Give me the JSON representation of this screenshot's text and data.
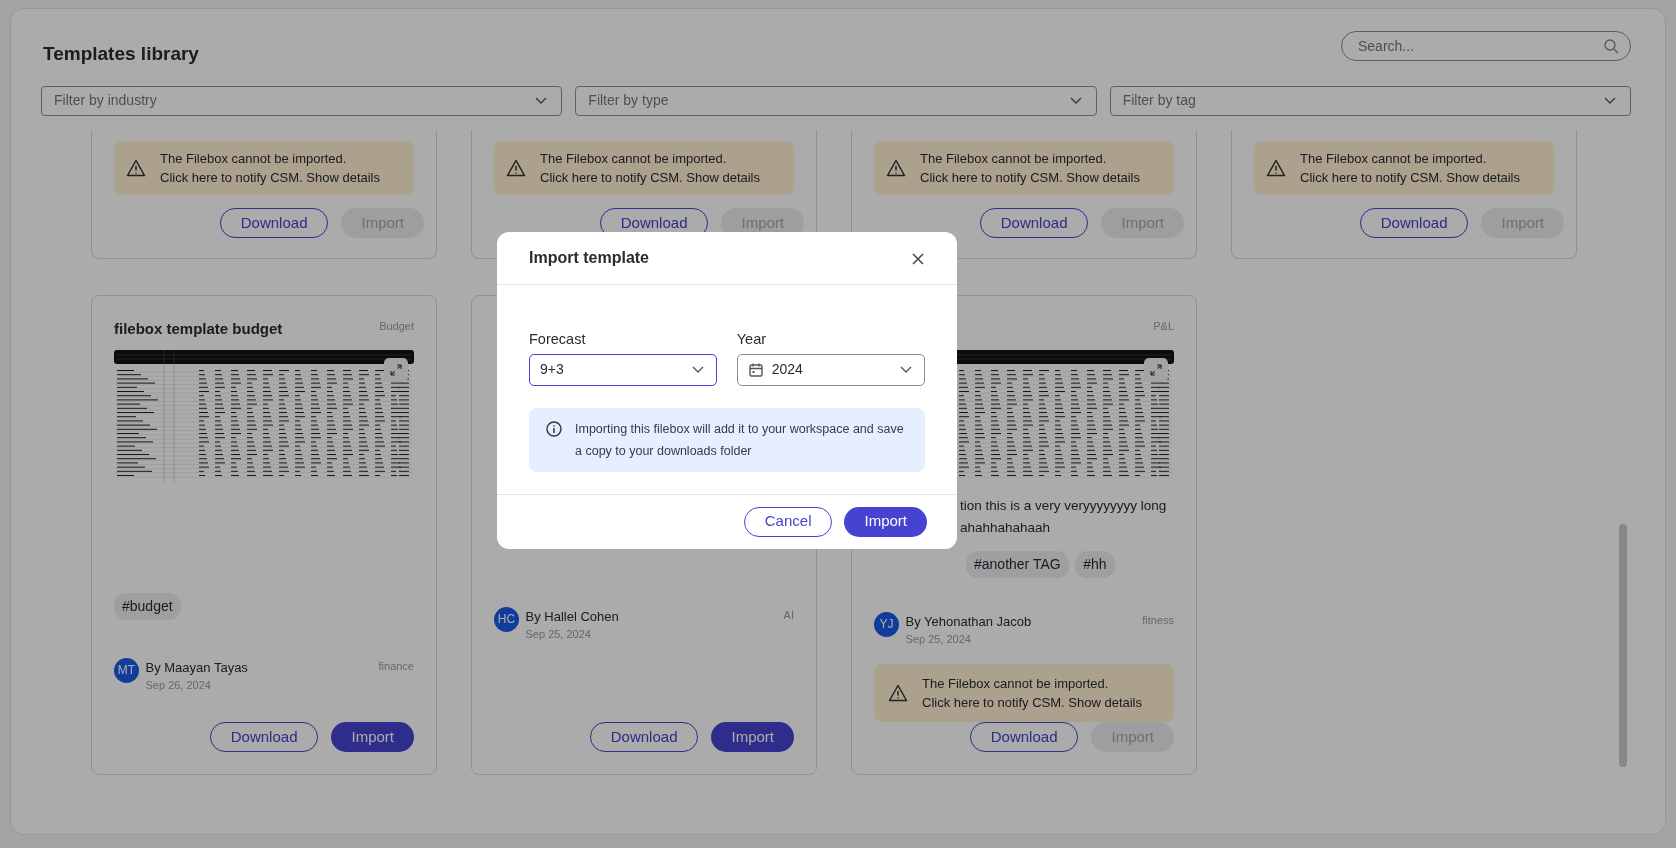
{
  "page": {
    "title": "Templates library",
    "search": {
      "placeholder": "Search..."
    },
    "filters": [
      {
        "placeholder": "Filter by industry"
      },
      {
        "placeholder": "Filter by type"
      },
      {
        "placeholder": "Filter by tag"
      }
    ]
  },
  "top_cards": [
    {
      "warning": {
        "text": "The Filebox cannot be imported.",
        "link": "Click here",
        "rest": "to notify CSM. Show details"
      },
      "buttons": [
        {
          "label": "Download",
          "kind": "outline",
          "disabled": false
        },
        {
          "label": "Import",
          "kind": "primary",
          "disabled": true
        }
      ]
    },
    {
      "warning": {
        "text": "The Filebox cannot be imported.",
        "link": "Click here",
        "rest": "to notify CSM. Show details"
      },
      "buttons": [
        {
          "label": "Download",
          "kind": "outline",
          "disabled": false
        },
        {
          "label": "Import",
          "kind": "primary",
          "disabled": true
        }
      ]
    },
    {
      "warning": {
        "text": "The Filebox cannot be imported.",
        "link": "Click here",
        "rest": "to notify CSM. Show details"
      },
      "buttons": [
        {
          "label": "Download",
          "kind": "outline",
          "disabled": false
        },
        {
          "label": "Import",
          "kind": "primary",
          "disabled": true
        }
      ]
    },
    {
      "warning": {
        "text": "The Filebox cannot be imported.",
        "link": "Click here",
        "rest": "to notify CSM. Show details"
      },
      "buttons": [
        {
          "label": "Download",
          "kind": "outline",
          "disabled": false
        },
        {
          "label": "Import",
          "kind": "primary",
          "disabled": true
        }
      ]
    }
  ],
  "cards": [
    {
      "title": "filebox template budget",
      "category": "Budget",
      "preview": true,
      "tags": [
        "#budget"
      ],
      "author": {
        "initials": "MT",
        "name": "By Maayan Tayas",
        "date": "Sep 26, 2024"
      },
      "industry": "finance",
      "buttons": [
        {
          "label": "Download",
          "kind": "outline",
          "disabled": false
        },
        {
          "label": "Import",
          "kind": "primary",
          "disabled": false
        }
      ]
    },
    {
      "preview": false,
      "author": {
        "initials": "HC",
        "name": "By Hallel Cohen",
        "date": "Sep 25, 2024"
      },
      "industry": "AI",
      "buttons": [
        {
          "label": "Download",
          "kind": "outline",
          "disabled": false
        },
        {
          "label": "Import",
          "kind": "primary",
          "disabled": false
        }
      ]
    },
    {
      "category": "P&L",
      "preview": true,
      "description": [
        "tion this is a very veryyyyyyyy long",
        "ahahhahahaah"
      ],
      "tags": [
        "#another TAG",
        "#hh"
      ],
      "author": {
        "initials": "YJ",
        "name": "By Yehonathan Jacob",
        "date": "Sep 25, 2024"
      },
      "industry": "fitness",
      "warning": {
        "text": "The Filebox cannot be imported.",
        "link": "Click here",
        "rest": "to notify CSM. Show details"
      },
      "buttons": [
        {
          "label": "Download",
          "kind": "outline",
          "disabled": false
        },
        {
          "label": "Import",
          "kind": "primary",
          "disabled": true
        }
      ]
    }
  ],
  "modal": {
    "title": "Import template",
    "fields": [
      {
        "label": "Forecast",
        "value": "9+3",
        "kind": "select",
        "focused": true
      },
      {
        "label": "Year",
        "value": "2024",
        "kind": "date",
        "focused": false
      }
    ],
    "info": "Importing this filebox will add it to your workspace and save a copy to your downloads folder",
    "buttons": [
      {
        "label": "Cancel",
        "kind": "outline",
        "disabled": false
      },
      {
        "label": "Import",
        "kind": "primary",
        "disabled": false
      }
    ]
  }
}
